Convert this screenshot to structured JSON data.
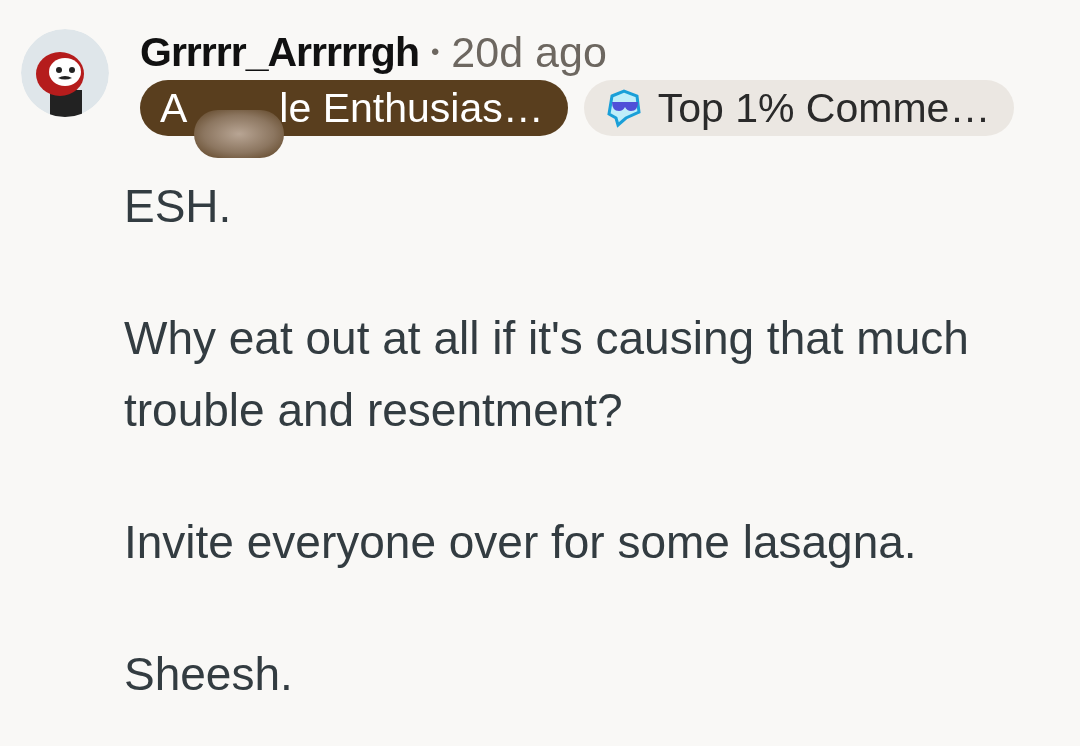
{
  "comment": {
    "author": "Grrrrr_Arrrrrgh",
    "separator": "•",
    "age": "20d ago",
    "flairs": [
      {
        "kind": "user",
        "prefix": "A",
        "text": "le Enthusias…",
        "redacted": true
      },
      {
        "kind": "achievement",
        "text": "Top 1% Comme…"
      }
    ],
    "paragraphs": [
      "ESH.",
      "Why eat out at all if it's causing that much trouble and resentment?",
      "Invite everyone over for some lasagna.",
      "Sheesh."
    ]
  }
}
